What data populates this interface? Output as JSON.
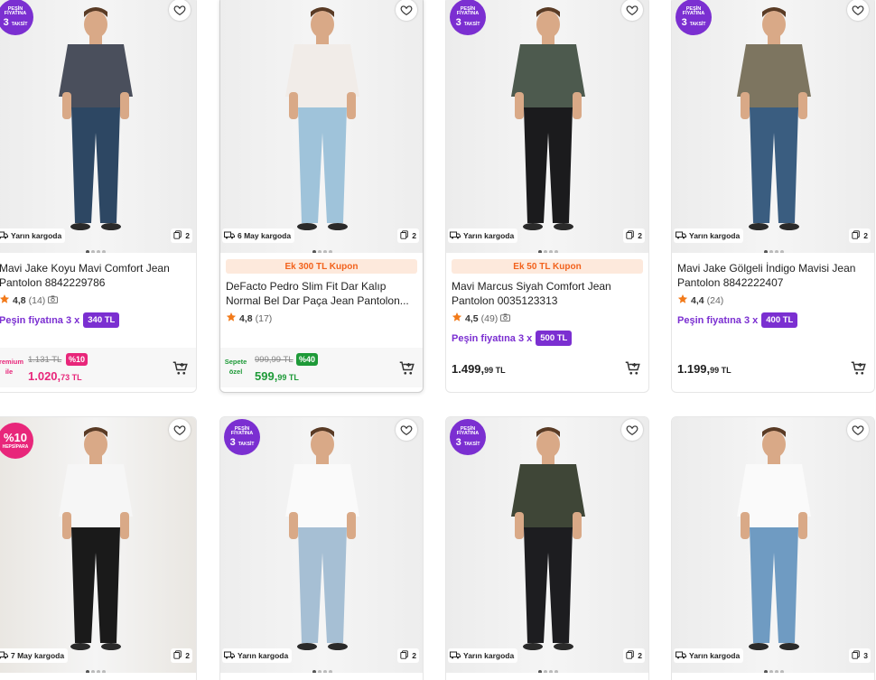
{
  "products": [
    {
      "badge": "pesin",
      "badge_text": [
        "PEŞİN",
        "FİYATINA",
        "3",
        "TAKSİT"
      ],
      "shipping": "Yarın kargoda",
      "image_count": "2",
      "title": "Mavi Jake Koyu Mavi Comfort Jean Pantolon 8842229786",
      "rating": "4,8",
      "review_count": "(14)",
      "has_camera": true,
      "installment_label": "Peşin fiyatına 3 x",
      "installment_amount": "340 TL",
      "price_type": "premium",
      "price_tag": [
        "Premium",
        "ile"
      ],
      "old_price": "1.131 TL",
      "discount": "%10",
      "price_main": "1.020,",
      "price_cents": "73 TL",
      "colors": {
        "shirt": "#4a4f5c",
        "pants": "#2d4763",
        "bg": "#ececec",
        "accent": "#e8267a"
      }
    },
    {
      "badge": "none",
      "shipping": "6 May kargoda",
      "image_count": "2",
      "coupon": "Ek 300 TL Kupon",
      "title": "DeFacto Pedro Slim Fit Dar Kalıp Normal Bel Dar Paça Jean Pantolon...",
      "rating": "4,8",
      "review_count": "(17)",
      "has_camera": false,
      "price_type": "sepet",
      "price_tag": [
        "Sepete",
        "özel"
      ],
      "old_price": "999,99 TL",
      "discount": "%40",
      "price_main": "599,",
      "price_cents": "99 TL",
      "colors": {
        "shirt": "#f1ece8",
        "pants": "#9fc3da",
        "bg": "#ededed",
        "accent": "#1e9a38"
      }
    },
    {
      "badge": "pesin",
      "badge_text": [
        "PEŞİN",
        "FİYATINA",
        "3",
        "TAKSİT"
      ],
      "shipping": "Yarın kargoda",
      "image_count": "2",
      "coupon": "Ek 50 TL Kupon",
      "title": "Mavi Marcus Siyah Comfort Jean Pantolon 0035123313",
      "rating": "4,5",
      "review_count": "(49)",
      "has_camera": true,
      "installment_label": "Peşin fiyatına 3 x",
      "installment_amount": "500 TL",
      "price_type": "plain",
      "price_main": "1.499,",
      "price_cents": "99 TL",
      "colors": {
        "shirt": "#4d5a4e",
        "pants": "#1b1b1d",
        "bg": "#ececec"
      }
    },
    {
      "badge": "pesin",
      "badge_text": [
        "PEŞİN",
        "FİYATINA",
        "3",
        "TAKSİT"
      ],
      "shipping": "Yarın kargoda",
      "image_count": "2",
      "title": "Mavi Jake Gölgeli İndigo Mavisi Jean Pantolon 8842222407",
      "rating": "4,4",
      "review_count": "(24)",
      "has_camera": false,
      "installment_label": "Peşin fiyatına 3 x",
      "installment_amount": "400 TL",
      "price_type": "plain",
      "price_main": "1.199,",
      "price_cents": "99 TL",
      "colors": {
        "shirt": "#7d7560",
        "pants": "#3a5d80",
        "bg": "#ececec"
      }
    },
    {
      "badge": "hepsi",
      "badge_text": [
        "%10",
        "HEPSİPARA"
      ],
      "shipping": "7 May kargoda",
      "image_count": "2",
      "colors": {
        "shirt": "#f6f6f6",
        "pants": "#1a1a1a",
        "bg": "#e9e6e1"
      }
    },
    {
      "badge": "pesin",
      "badge_text": [
        "PEŞİN",
        "FİYATINA",
        "3",
        "TAKSİT"
      ],
      "shipping": "Yarın kargoda",
      "image_count": "2",
      "colors": {
        "shirt": "#fafafa",
        "pants": "#a6bfd4",
        "bg": "#ededed"
      }
    },
    {
      "badge": "pesin",
      "badge_text": [
        "PEŞİN",
        "FİYATINA",
        "3",
        "TAKSİT"
      ],
      "shipping": "Yarın kargoda",
      "image_count": "2",
      "colors": {
        "shirt": "#3f4637",
        "pants": "#1d1d20",
        "bg": "#ececec"
      }
    },
    {
      "badge": "none",
      "shipping": "Yarın kargoda",
      "image_count": "3",
      "colors": {
        "shirt": "#fafafa",
        "pants": "#6f9bc2",
        "bg": "#ececec"
      }
    }
  ]
}
